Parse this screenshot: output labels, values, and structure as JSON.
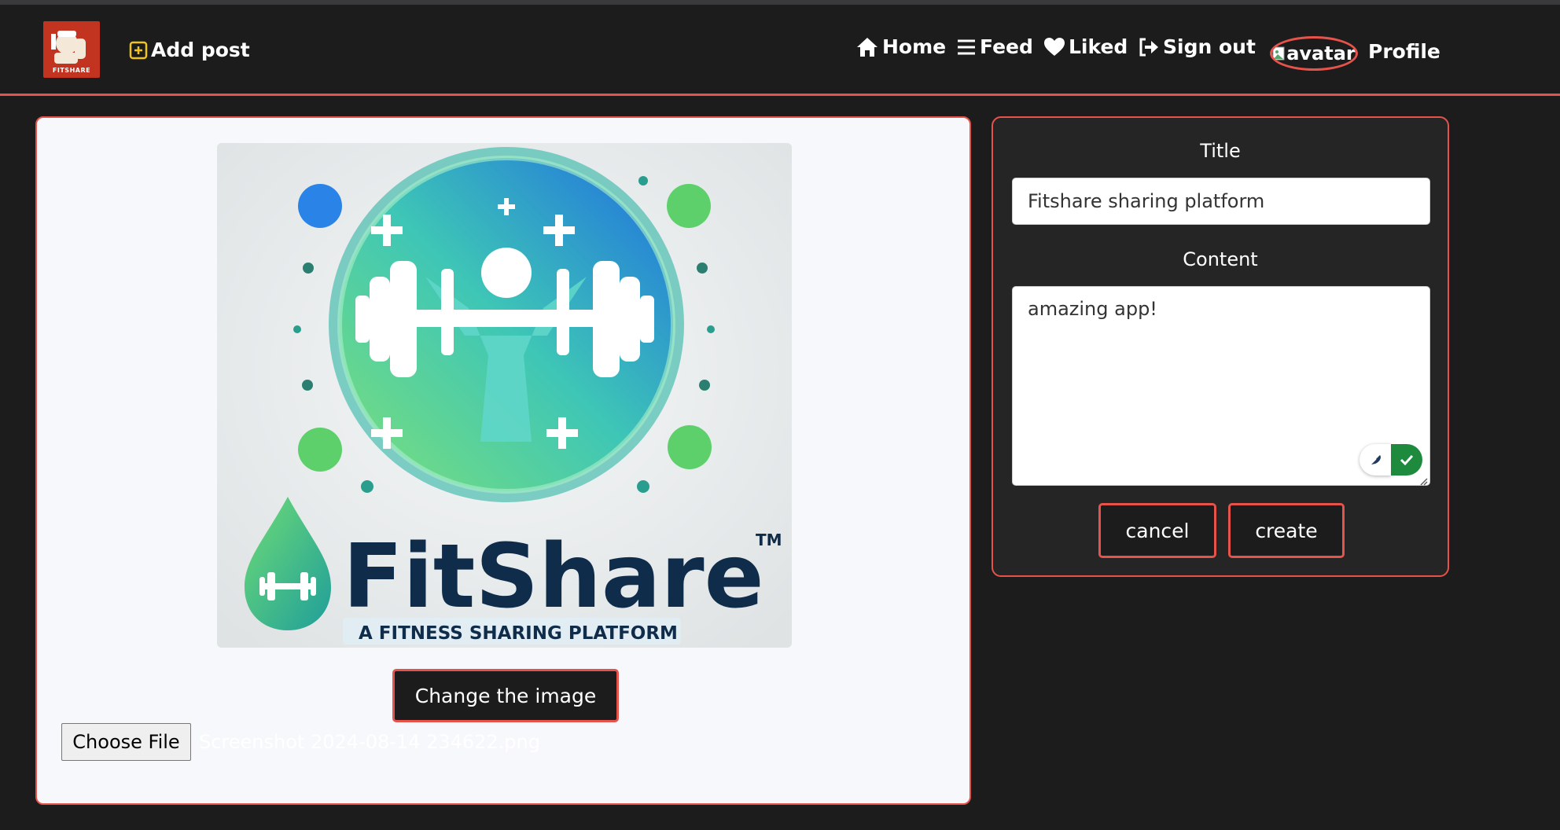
{
  "brand": {
    "logo_text": "FITSHARE",
    "accent_color": "#e5534b"
  },
  "nav": {
    "add_post": "Add post",
    "home": "Home",
    "feed": "Feed",
    "liked": "Liked",
    "sign_out": "Sign out",
    "avatar_alt": "avatar",
    "profile": "Profile"
  },
  "image_panel": {
    "preview": {
      "brand_name": "FitShare",
      "trademark": "TM",
      "tagline": "A FITNESS SHARING PLATFORM"
    },
    "change_button": "Change the image",
    "choose_file_button": "Choose File",
    "file_name": "Screenshot 2024-08-14 234622.png"
  },
  "form": {
    "title_label": "Title",
    "title_value": "Fitshare sharing platform",
    "content_label": "Content",
    "content_value": "amazing app!",
    "cancel_button": "cancel",
    "create_button": "create"
  },
  "icons": {
    "add_post": "plus-square-icon",
    "home": "home-icon",
    "feed": "menu-icon",
    "liked": "heart-icon",
    "sign_out": "sign-out-icon",
    "grammar_feather": "feather-icon",
    "grammar_check": "check-icon"
  }
}
